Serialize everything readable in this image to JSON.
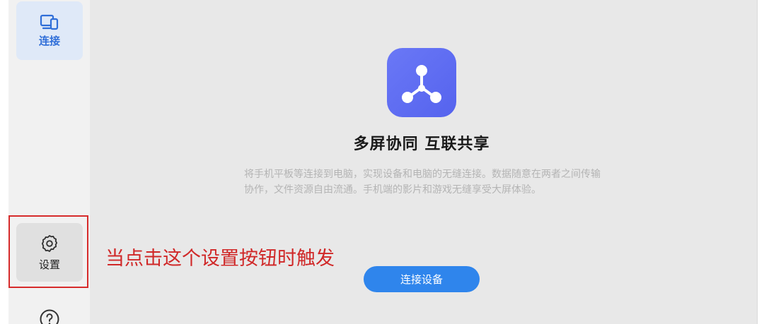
{
  "sidebar": {
    "items": [
      {
        "label": "连接",
        "icon": "devices-icon",
        "active": true
      },
      {
        "label": "设置",
        "icon": "gear-icon",
        "active": false
      },
      {
        "label": "",
        "icon": "help-icon",
        "active": false
      }
    ]
  },
  "main": {
    "logo_icon": "share-network-icon",
    "title": "多屏协同 互联共享",
    "description": "将手机平板等连接到电脑，实现设备和电脑的无缝连接。数据随意在两者之间传输协作，文件资源自由流通。手机端的影片和游戏无缝享受大屏体验。",
    "connect_button_label": "连接设备"
  },
  "annotation": {
    "text": "当点击这个设置按钮时触发"
  },
  "colors": {
    "accent": "#2f85ec",
    "active_nav_bg": "#dfe9f8",
    "active_nav_text": "#2f6ed8",
    "logo_gradient_start": "#6a78f6",
    "logo_gradient_end": "#5563ee",
    "annotation_red": "#d02828"
  }
}
